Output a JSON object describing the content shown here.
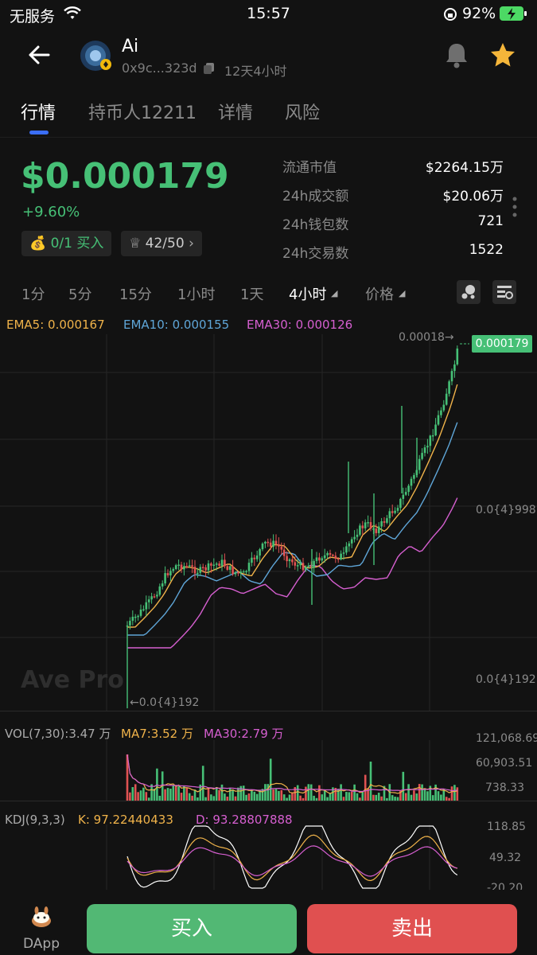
{
  "status_bar": {
    "carrier": "无服务",
    "time": "15:57",
    "battery": "92%"
  },
  "token": {
    "name": "Ai",
    "address": "0x9c...323d",
    "age": "12天4小时"
  },
  "tabs": [
    {
      "label": "行情"
    },
    {
      "label": "持币人12211"
    },
    {
      "label": "详情"
    },
    {
      "label": "风险"
    }
  ],
  "price": {
    "value": "$0.000179",
    "change": "+9.60%"
  },
  "chips": {
    "buy_count": "0/1",
    "buy_label": "买入",
    "rank": "42/50"
  },
  "stats": [
    {
      "label": "流通市值",
      "value": "$2264.15万"
    },
    {
      "label": "24h成交额",
      "value": "$20.06万"
    },
    {
      "label": "24h钱包数",
      "value": "721"
    },
    {
      "label": "24h交易数",
      "value": "1522"
    }
  ],
  "timeframes": [
    "1分",
    "5分",
    "15分",
    "1小时",
    "1天",
    "4小时",
    "价格"
  ],
  "indicators": {
    "ema5": "EMA5: 0.000167",
    "ema10": "EMA10: 0.000155",
    "ema30": "EMA30: 0.000126"
  },
  "price_axis": {
    "high_marker": "0.00018→",
    "current_tag": "0.000179",
    "mid": "0.0{4}998",
    "low": "0.0{4}192",
    "low_marker": "←0.0{4}192"
  },
  "watermark": "Ave Pro",
  "volume": {
    "label": "VOL(7,30):3.47 万",
    "ma7": "MA7:3.52 万",
    "ma30": "MA30:2.79 万",
    "axis": [
      "121,068.69",
      "60,903.51",
      "738.33"
    ]
  },
  "kdj": {
    "label": "KDJ(9,3,3)",
    "k": "K:  97.22440433",
    "d": "D:  93.28807888",
    "axis": [
      "118.85",
      "49.32",
      "-20.20"
    ]
  },
  "bottom": {
    "dapp": "DApp",
    "buy": "买入",
    "sell": "卖出"
  },
  "colors": {
    "up": "#46c076",
    "down": "#e05252",
    "accent": "#3b6ef5",
    "ema5": "#f0b34a",
    "ema10": "#5fa6d8",
    "ema30": "#d65fd0",
    "star": "#f5b63a"
  },
  "chart_data": {
    "type": "candlestick",
    "timeframe": "4小时",
    "close_price": [
      1.92e-05,
      3.5e-05,
      5e-05,
      5.6e-05,
      5.8e-05,
      6e-05,
      6.4e-05,
      6.2e-05,
      6.8e-05,
      7.4e-05,
      7.6e-05,
      7.3e-05,
      7e-05,
      7.2e-05,
      7.8e-05,
      8.5e-05,
      9.4e-05,
      9.8e-05,
      0.000108,
      0.00012,
      0.000135,
      0.00015,
      0.000165,
      0.000179
    ],
    "current": 0.000179,
    "high": 0.00018
  }
}
